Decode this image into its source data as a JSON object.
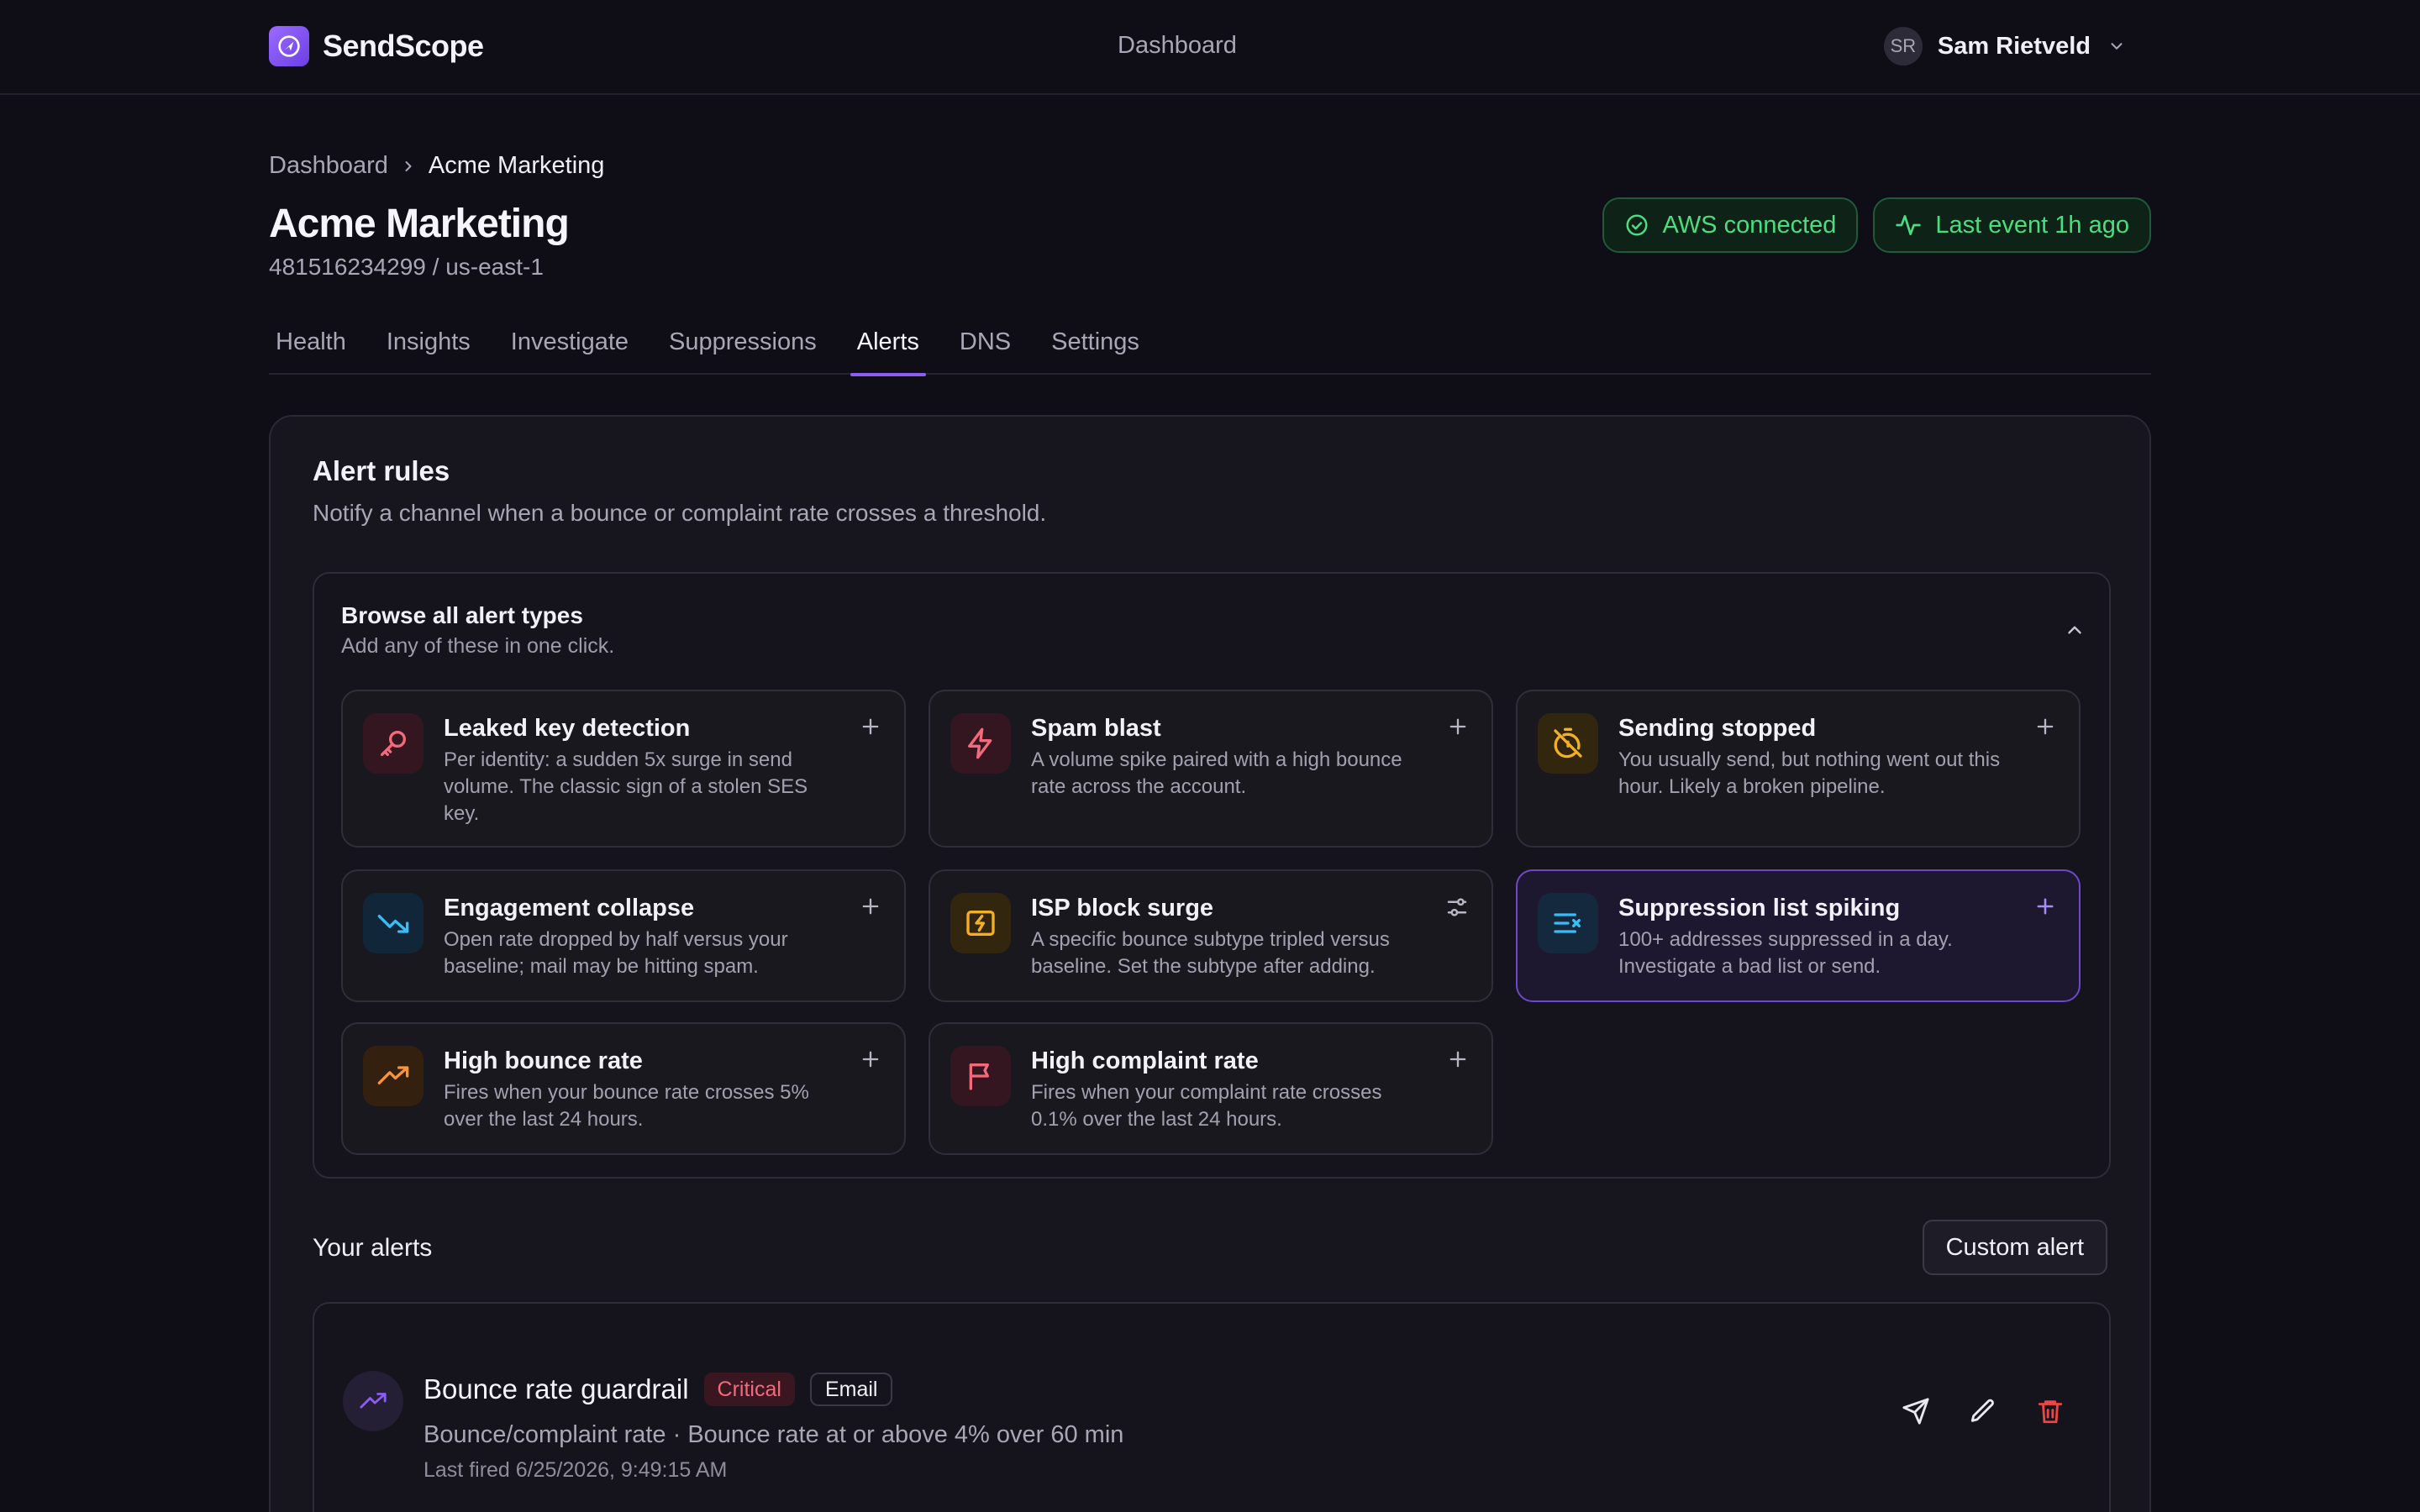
{
  "app": {
    "name": "SendScope"
  },
  "topnav": {
    "center_link": "Dashboard"
  },
  "user": {
    "initials": "SR",
    "name": "Sam Rietveld"
  },
  "breadcrumb": {
    "root": "Dashboard",
    "current": "Acme Marketing"
  },
  "page": {
    "title": "Acme Marketing",
    "subtitle": "481516234299 / us-east-1"
  },
  "status": {
    "aws": "AWS connected",
    "last_event": "Last event 1h ago",
    "color": "#4ade80"
  },
  "tabs": [
    {
      "label": "Health"
    },
    {
      "label": "Insights"
    },
    {
      "label": "Investigate"
    },
    {
      "label": "Suppressions"
    },
    {
      "label": "Alerts",
      "active": true
    },
    {
      "label": "DNS"
    },
    {
      "label": "Settings"
    }
  ],
  "alert_rules": {
    "title": "Alert rules",
    "description": "Notify a channel when a bounce or complaint rate crosses a threshold."
  },
  "browse": {
    "title": "Browse all alert types",
    "description": "Add any of these in one click.",
    "types": [
      {
        "name": "Leaked key detection",
        "desc": "Per identity: a sudden 5x surge in send volume. The classic sign of a stolen SES key.",
        "icon": "key-icon",
        "accent": "#f26b7c",
        "action": "plus-icon"
      },
      {
        "name": "Spam blast",
        "desc": "A volume spike paired with a high bounce rate across the account.",
        "icon": "bolt-icon",
        "accent": "#f26b7c",
        "action": "plus-icon"
      },
      {
        "name": "Sending stopped",
        "desc": "You usually send, but nothing went out this hour. Likely a broken pipeline.",
        "icon": "timer-off-icon",
        "accent": "#f5b021",
        "action": "plus-icon"
      },
      {
        "name": "Engagement collapse",
        "desc": "Open rate dropped by half versus your baseline; mail may be hitting spam.",
        "icon": "trending-down-icon",
        "accent": "#38bdf8",
        "action": "plus-icon"
      },
      {
        "name": "ISP block surge",
        "desc": "A specific bounce subtype tripled versus baseline. Set the subtype after adding.",
        "icon": "zap-block-icon",
        "accent": "#f5b021",
        "action": "sliders-icon"
      },
      {
        "name": "Suppression list spiking",
        "desc": "100+ addresses suppressed in a day. Investigate a bad list or send.",
        "icon": "list-x-icon",
        "accent": "#38bdf8",
        "action": "plus-icon",
        "highlighted": true
      },
      {
        "name": "High bounce rate",
        "desc": "Fires when your bounce rate crosses 5% over the last 24 hours.",
        "icon": "trending-up-icon",
        "accent": "#fb923c",
        "action": "plus-icon"
      },
      {
        "name": "High complaint rate",
        "desc": "Fires when your complaint rate crosses 0.1% over the last 24 hours.",
        "icon": "flag-icon",
        "accent": "#f26b7c",
        "action": "plus-icon"
      }
    ]
  },
  "your_alerts": {
    "title": "Your alerts",
    "custom_button": "Custom alert",
    "items": [
      {
        "name": "Bounce rate guardrail",
        "severity": "Critical",
        "channel": "Email",
        "description": "Bounce/complaint rate · Bounce rate at or above 4% over 60 min",
        "last_fired": "Last fired 6/25/2026, 9:49:15 AM"
      }
    ]
  }
}
